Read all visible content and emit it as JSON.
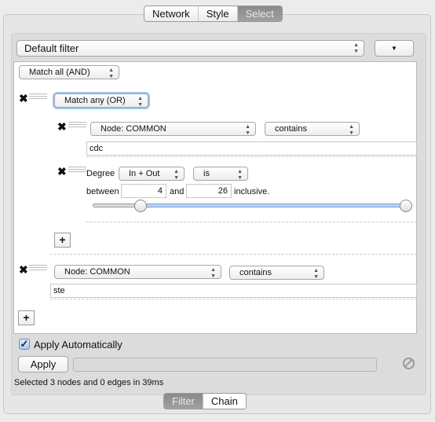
{
  "top_tabs": [
    {
      "label": "Network",
      "selected": false
    },
    {
      "label": "Style",
      "selected": false
    },
    {
      "label": "Select",
      "selected": true
    }
  ],
  "filter_select": {
    "value": "Default filter",
    "menu_icon": "triangle-down-icon"
  },
  "root": {
    "match": "Match all (AND)"
  },
  "group": {
    "match": "Match any (OR)",
    "condition1": {
      "column": "Node: COMMON",
      "operator": "contains",
      "value": "cdc"
    },
    "condition2": {
      "label": "Degree",
      "direction": "In + Out",
      "operator": "is",
      "between_label": "between",
      "min": "4",
      "and_label": "and",
      "max": "26",
      "inclusive_label": "inclusive.",
      "slider": {
        "range_min": 4,
        "range_max": 26,
        "low": 4,
        "high": 26
      }
    }
  },
  "condition3": {
    "column": "Node: COMMON",
    "operator": "contains",
    "value": "ste"
  },
  "add_label": "+",
  "apply_automatically": {
    "label": "Apply Automatically",
    "checked": true
  },
  "apply_button": "Apply",
  "progress": 0,
  "status": "Selected 3 nodes and 0 edges in 39ms",
  "bottom_tabs": [
    {
      "label": "Filter",
      "selected": true
    },
    {
      "label": "Chain",
      "selected": false
    }
  ],
  "colors": {
    "accent": "#5b8fd6",
    "slider_fill": "#b9d3f2"
  }
}
